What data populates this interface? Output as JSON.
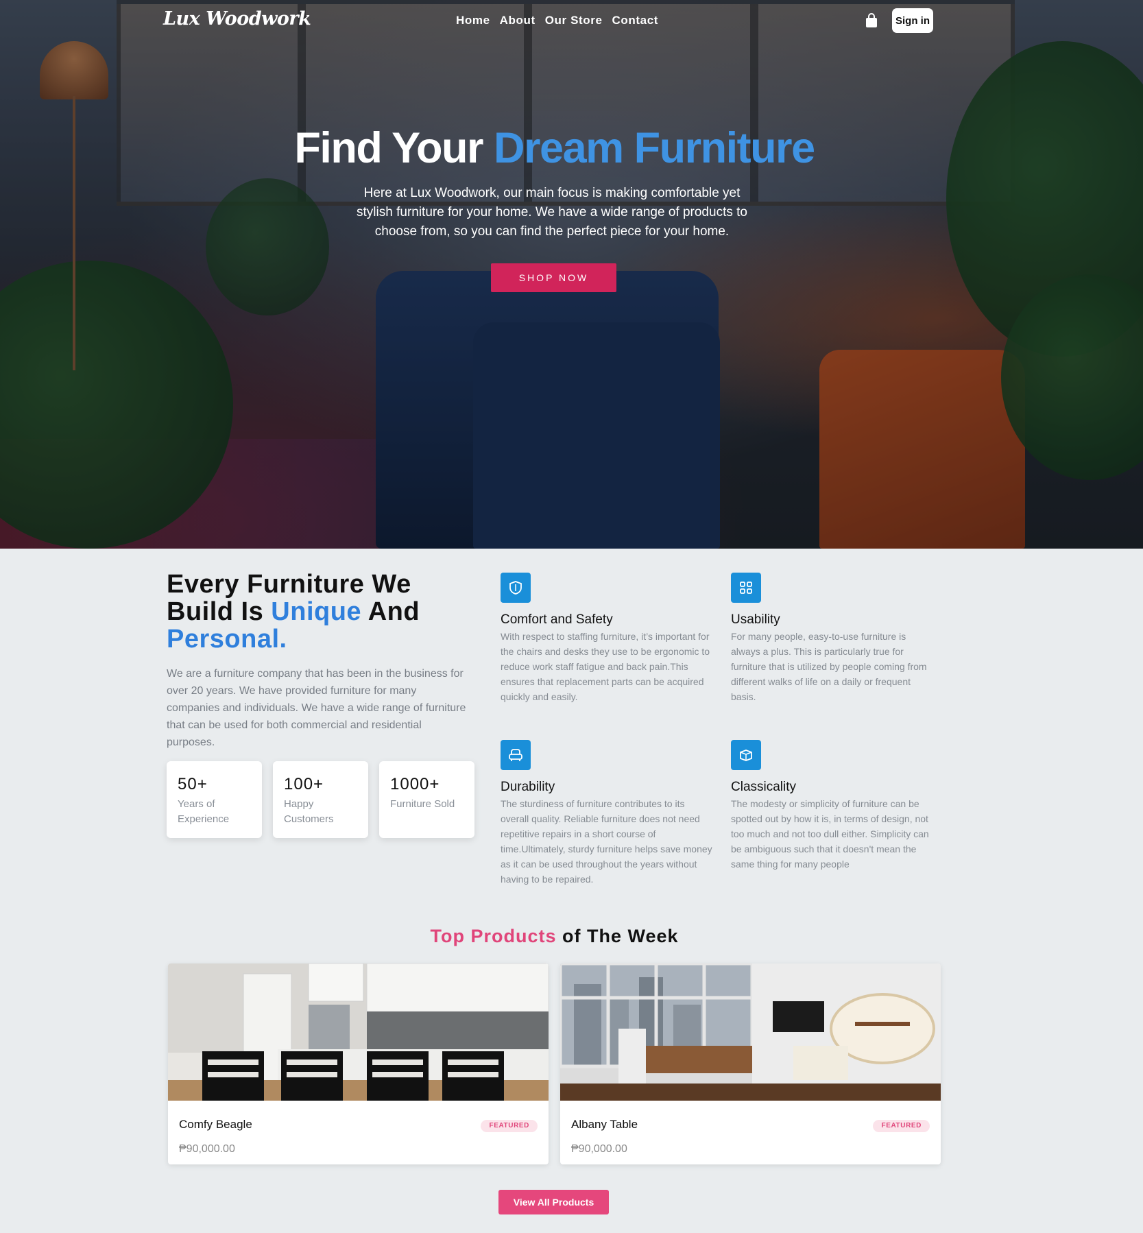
{
  "nav": {
    "logo": "Lux Woodwork",
    "links": [
      "Home",
      "About",
      "Our Store",
      "Contact"
    ],
    "cart_icon": "shopping-bag-icon",
    "signin_label": "Sign in"
  },
  "hero": {
    "title_start": "Find Your ",
    "title_accent": "Dream Furniture",
    "description": "Here at Lux Woodwork, our main focus is making comfortable yet stylish furniture for your home. We have a wide range of products to choose from, so you can find the perfect piece for your home.",
    "cta_label": "SHOP NOW"
  },
  "about": {
    "title_line1": "Every Furniture We",
    "title_line2_start": "Build Is ",
    "title_line2_blue": "Unique",
    "title_line2_end": " And",
    "title_line3": "Personal.",
    "text": "We are a furniture company that has been in the business for over 20 years. We have provided furniture for many companies and individuals. We have a wide range of furniture that can be used for both commercial and residential purposes.",
    "stats": [
      {
        "number": "50+",
        "label": "Years of Experience"
      },
      {
        "number": "100+",
        "label": "Happy Customers"
      },
      {
        "number": "1000+",
        "label": "Furniture Sold"
      }
    ]
  },
  "features": [
    {
      "icon": "shield-icon",
      "title": "Comfort and Safety",
      "text": "With respect to staffing furniture, it’s important for the chairs and desks they use to be ergonomic to reduce work staff fatigue and back pain.This ensures that replacement parts can be acquired quickly and easily."
    },
    {
      "icon": "grid-icon",
      "title": "Usability",
      "text": "For many people, easy-to-use furniture is always a plus. This is particularly true for furniture that is utilized by people coming from different walks of life on a daily or frequent basis."
    },
    {
      "icon": "armchair-icon",
      "title": "Durability",
      "text": "The sturdiness of furniture contributes to its overall quality. Reliable furniture does not need repetitive repairs in a short course of time.Ultimately, sturdy furniture helps save money as it can be used throughout the years without having to be repaired."
    },
    {
      "icon": "box-icon",
      "title": "Classicality",
      "text": "The modesty or simplicity of furniture can be spotted out by how it is, in terms of design, not too much and not too dull either. Simplicity can be ambiguous such that it doesn't mean the same thing for many people"
    }
  ],
  "products_section": {
    "title_pink": "Top Products",
    "title_rest": " of The Week",
    "view_all_label": "View All Products"
  },
  "products": [
    {
      "name": "Comfy Beagle",
      "price": "₱90,000.00",
      "badge": "FEATURED"
    },
    {
      "name": "Albany Table",
      "price": "₱90,000.00",
      "badge": "FEATURED"
    }
  ],
  "colors": {
    "accent_blue": "#3f93e3",
    "cta_red": "#d1245a",
    "pink": "#e0457a",
    "icon_blue": "#1a8fd9",
    "background": "#e9ecee"
  }
}
